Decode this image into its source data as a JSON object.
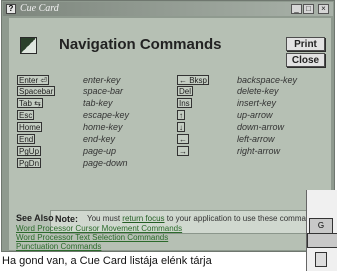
{
  "window": {
    "title": "Cue Card",
    "minimize_glyph": "_",
    "maximize_glyph": "□",
    "close_glyph": "×"
  },
  "header": {
    "title": "Navigation Commands",
    "icon": "navigation-card-icon"
  },
  "buttons": {
    "print": "Print",
    "close": "Close"
  },
  "left_commands": [
    {
      "key": "Enter ⏎",
      "desc": "enter-key"
    },
    {
      "key": "Spacebar",
      "desc": "space-bar"
    },
    {
      "key": "Tab ⇆",
      "desc": "tab-key"
    },
    {
      "key": "Esc",
      "desc": "escape-key"
    },
    {
      "key": "Home",
      "desc": "home-key"
    },
    {
      "key": "End",
      "desc": "end-key"
    },
    {
      "key": "PgUp",
      "desc": "page-up"
    },
    {
      "key": "PgDn",
      "desc": "page-down"
    }
  ],
  "right_commands": [
    {
      "key": "← Bksp",
      "desc": "backspace-key"
    },
    {
      "key": "Del",
      "desc": "delete-key"
    },
    {
      "key": "Ins",
      "desc": "insert-key"
    },
    {
      "key": "↑",
      "desc": "up-arrow"
    },
    {
      "key": "↓",
      "desc": "down-arrow"
    },
    {
      "key": "←",
      "desc": "left-arrow"
    },
    {
      "key": "→",
      "desc": "right-arrow"
    }
  ],
  "note": {
    "label": "Note:",
    "before": "You must ",
    "link": "return focus",
    "after": " to your application to use these commands."
  },
  "see_also": {
    "title": "See Also",
    "links": [
      "Word Processor Cursor Movement Commands",
      "Word Processor Text Selection Commands",
      "Punctuation Commands"
    ]
  },
  "caption": "Ha gond van, a Cue Card listája elénk tárja"
}
